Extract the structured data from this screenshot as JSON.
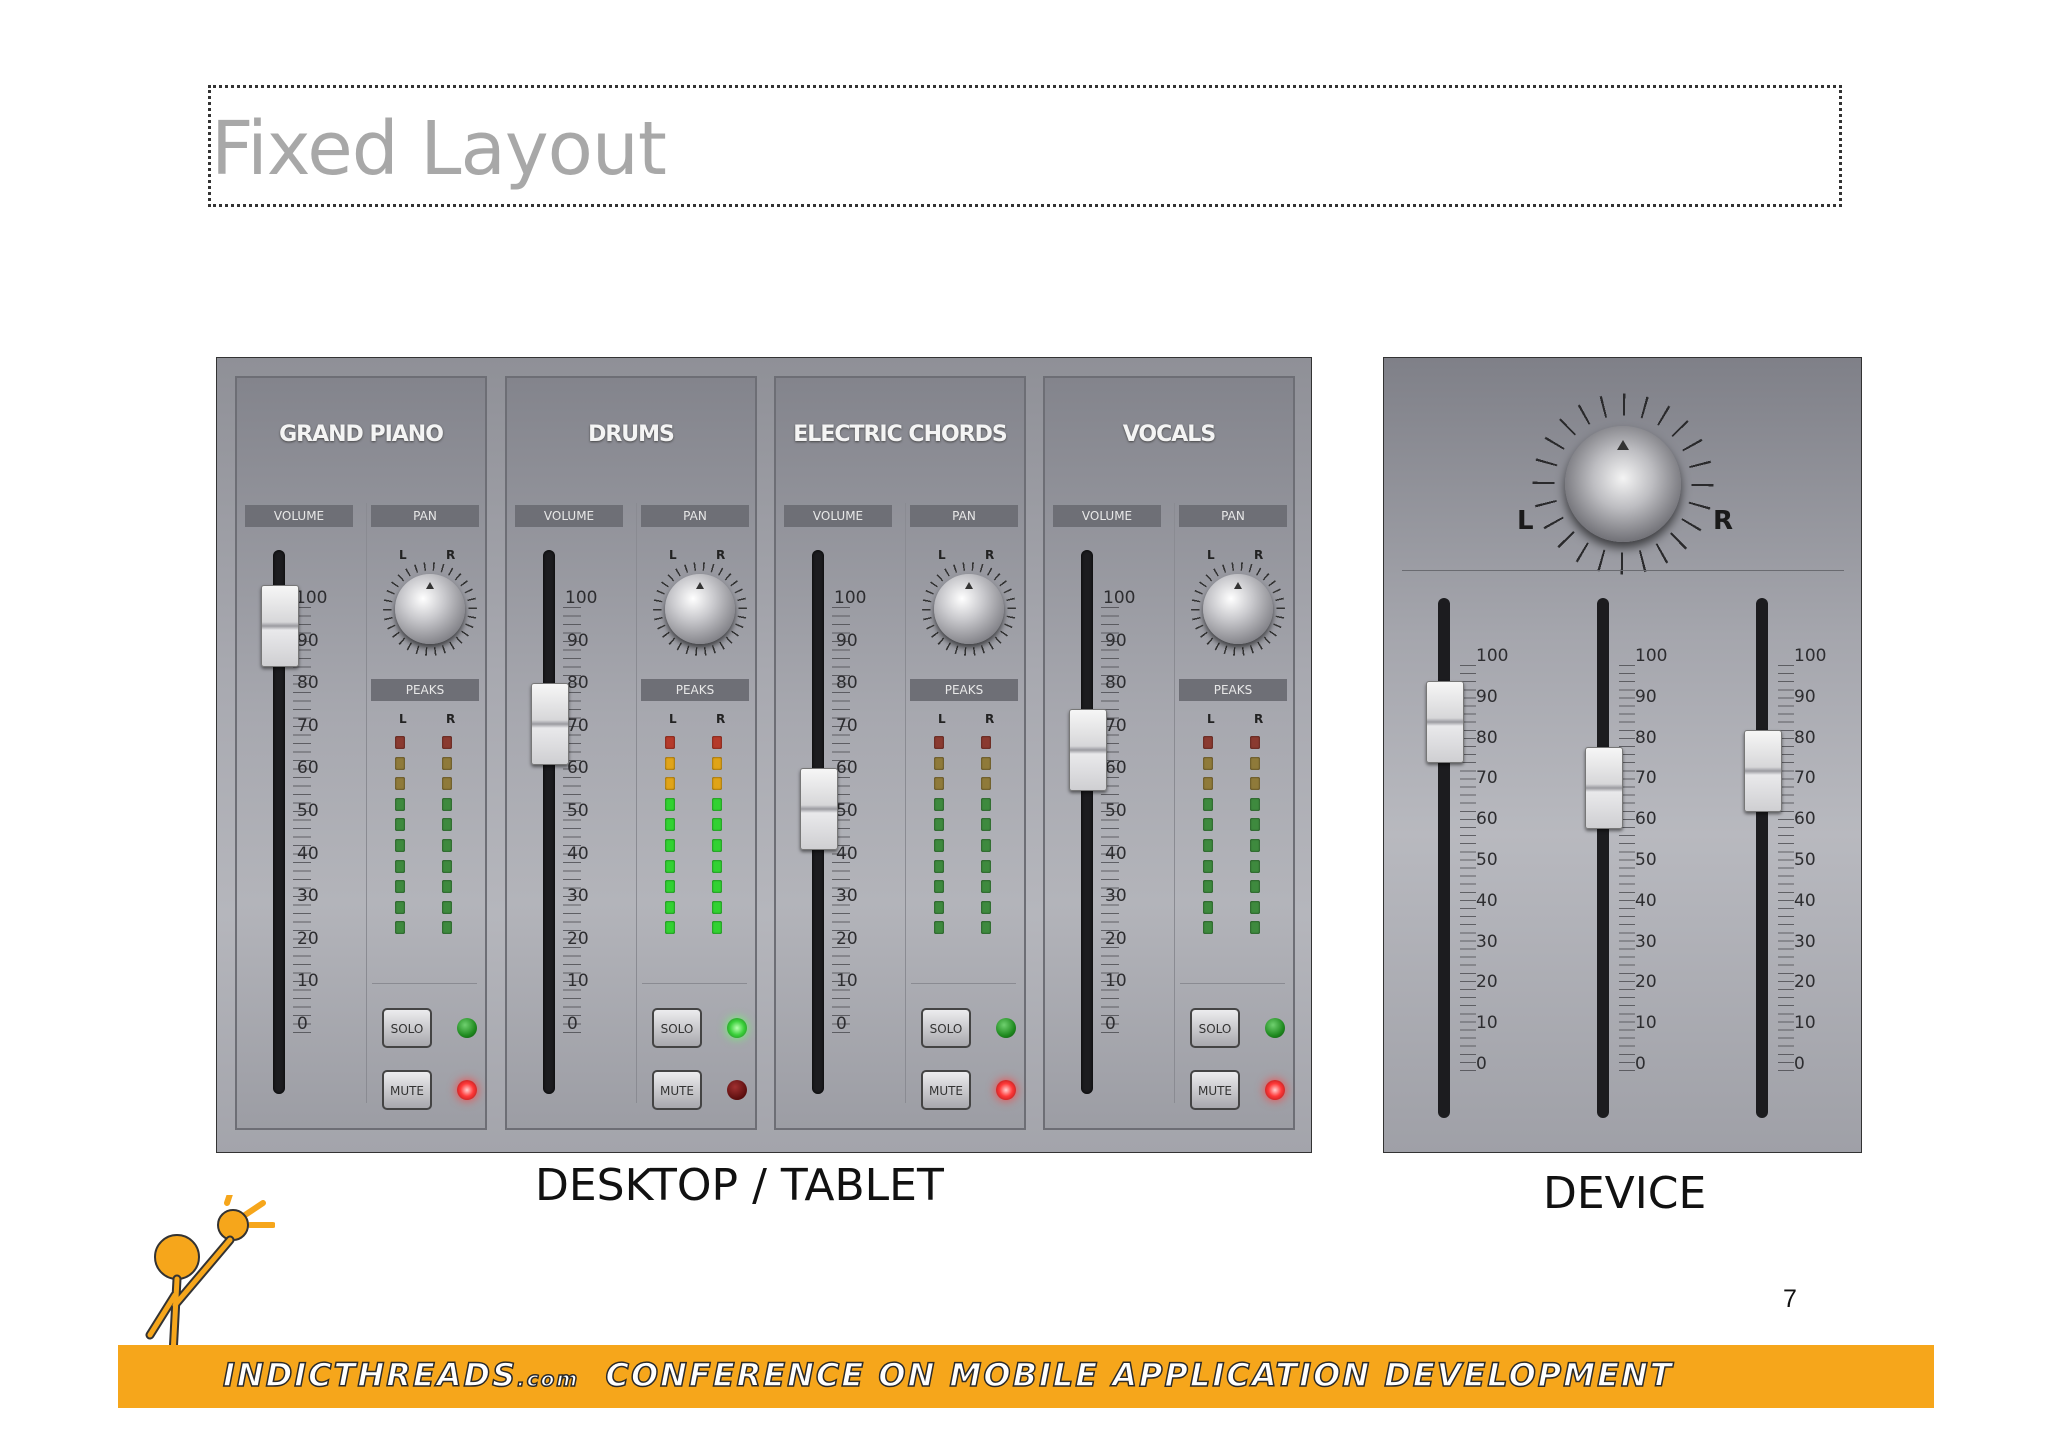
{
  "slide": {
    "title": "Fixed Layout",
    "caption_left": "DESKTOP / TABLET",
    "caption_right": "DEVICE",
    "page_number": "7",
    "footer_brand": "INDICTHREADS",
    "footer_domain": ".com",
    "footer_text": "CONFERENCE ON MOBILE APPLICATION DEVELOPMENT"
  },
  "mixer": {
    "labels": {
      "volume": "VOLUME",
      "pan": "PAN",
      "peaks": "PEAKS",
      "left": "L",
      "right": "R",
      "solo": "SOLO",
      "mute": "MUTE"
    },
    "scale": [
      "100",
      "90",
      "80",
      "70",
      "60",
      "50",
      "40",
      "30",
      "20",
      "10",
      "0"
    ],
    "channels": [
      {
        "name": "GRAND PIANO",
        "volume": 95,
        "solo_on": false,
        "mute_on": true,
        "peak_level": 8
      },
      {
        "name": "DRUMS",
        "volume": 72,
        "solo_on": true,
        "mute_on": false,
        "peak_level": 11
      },
      {
        "name": "ELECTRIC CHORDS",
        "volume": 52,
        "solo_on": false,
        "mute_on": true,
        "peak_level": 7
      },
      {
        "name": "VOCALS",
        "volume": 66,
        "solo_on": false,
        "mute_on": true,
        "peak_level": 7
      }
    ]
  },
  "device": {
    "labels": {
      "left": "L",
      "right": "R"
    },
    "scale": [
      "100",
      "90",
      "80",
      "70",
      "60",
      "50",
      "40",
      "30",
      "20",
      "10",
      "0"
    ],
    "sliders": [
      {
        "value": 84
      },
      {
        "value": 68
      },
      {
        "value": 72
      }
    ]
  },
  "colors": {
    "accent_footer": "#f6a61b",
    "led_green": "#2fbf2f",
    "led_amber": "#d9a21c",
    "led_red": "#c0392b"
  }
}
